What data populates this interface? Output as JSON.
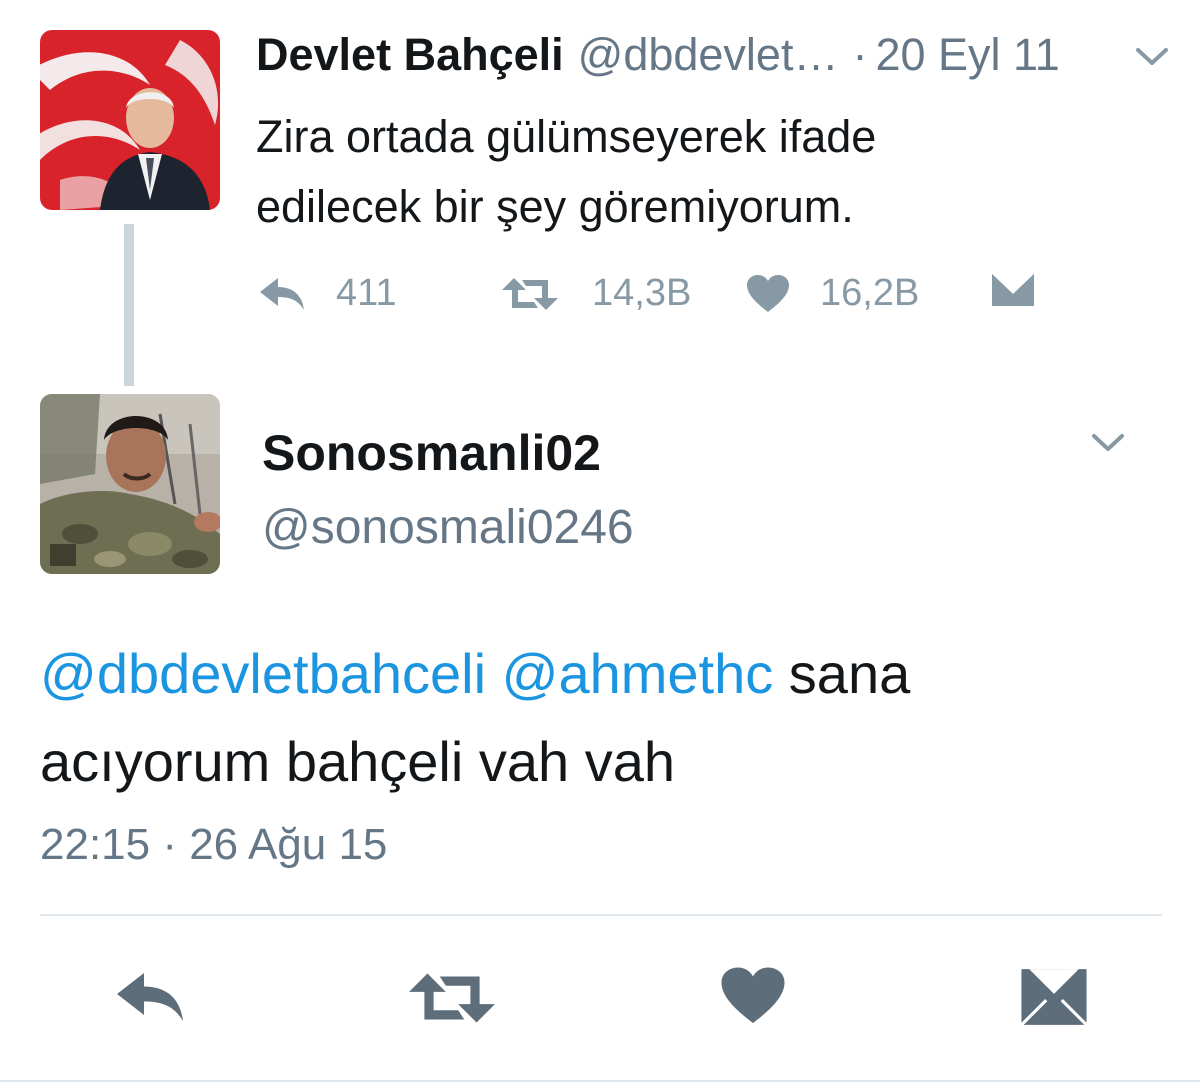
{
  "parent_tweet": {
    "display_name": "Devlet Bahçeli",
    "handle": "@dbdevlet…",
    "separator": "·",
    "date": "20 Eyl 11",
    "text_line1": "Zira ortada gülümseyerek ifade",
    "text_line2": "edilecek bir şey göremiyorum.",
    "actions": {
      "reply_count": "411",
      "retweet_count": "14,3B",
      "like_count": "16,2B"
    }
  },
  "reply_tweet": {
    "display_name": "Sonosmanli02",
    "handle": "@sonosmali0246",
    "mention1": "@dbdevletbahceli",
    "mention2": "@ahmethc",
    "text_after_mentions": "sana",
    "text_line2": "acıyorum bahçeli vah vah",
    "timestamp": "22:15 · 26 Ağu 15"
  },
  "colors": {
    "text_primary": "#14171a",
    "text_secondary": "#657786",
    "icon_gray": "#8899a6",
    "icon_dark": "#5e6d7a",
    "link_blue": "#1b95e0",
    "divider": "#e1e8ed",
    "thread_line": "#ccd6dd"
  },
  "icons": {
    "parent_avatar": "profile-photo",
    "reply_avatar": "profile-photo",
    "caret": "chevron-down-icon",
    "reply": "reply-arrow-icon",
    "retweet": "retweet-icon",
    "like": "heart-icon",
    "dm": "envelope-icon"
  }
}
